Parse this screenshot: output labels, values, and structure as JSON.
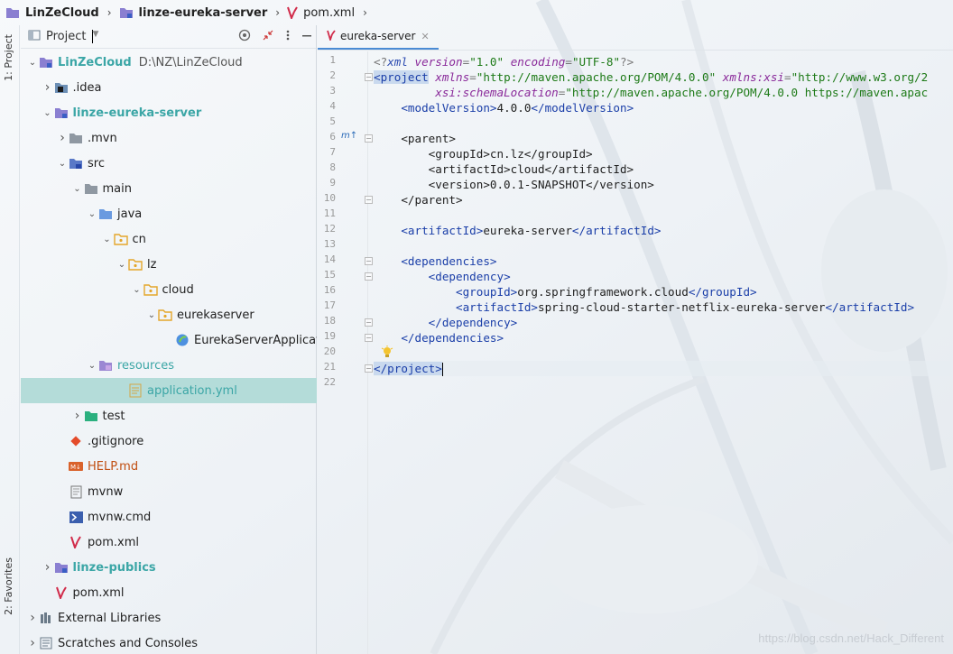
{
  "breadcrumb": {
    "items": [
      {
        "label": "LinZeCloud",
        "icon": "folder-icon"
      },
      {
        "label": "linze-eureka-server",
        "icon": "folder-icon"
      },
      {
        "label": "pom.xml",
        "icon": "maven-icon"
      }
    ]
  },
  "left_strip": {
    "project_tab": "1: Project",
    "favorites_tab": "2: Favorites"
  },
  "project_panel": {
    "title": "Project",
    "tree": [
      {
        "label": "LinZeCloud",
        "path": "D:\\NZ\\LinZeCloud",
        "depth": 0,
        "arrow": "open",
        "icon": "folder-module",
        "color": "#3ba6a6",
        "bold": true
      },
      {
        "label": ".idea",
        "depth": 1,
        "arrow": "closed",
        "icon": "folder-idea",
        "color": "#1f1f1f"
      },
      {
        "label": "linze-eureka-server",
        "depth": 1,
        "arrow": "open",
        "icon": "folder-module",
        "color": "#3ba6a6",
        "bold": true
      },
      {
        "label": ".mvn",
        "depth": 2,
        "arrow": "closed",
        "icon": "folder-gray",
        "color": "#1f1f1f"
      },
      {
        "label": "src",
        "depth": 2,
        "arrow": "open",
        "icon": "folder-src",
        "color": "#1f1f1f"
      },
      {
        "label": "main",
        "depth": 3,
        "arrow": "open",
        "icon": "folder-gray",
        "color": "#1f1f1f"
      },
      {
        "label": "java",
        "depth": 4,
        "arrow": "open",
        "icon": "folder-blue",
        "color": "#1f1f1f"
      },
      {
        "label": "cn",
        "depth": 5,
        "arrow": "open",
        "icon": "package",
        "color": "#1f1f1f"
      },
      {
        "label": "lz",
        "depth": 6,
        "arrow": "open",
        "icon": "package",
        "color": "#1f1f1f"
      },
      {
        "label": "cloud",
        "depth": 7,
        "arrow": "open",
        "icon": "package",
        "color": "#1f1f1f"
      },
      {
        "label": "eurekaserver",
        "depth": 8,
        "arrow": "open",
        "icon": "package",
        "color": "#1f1f1f"
      },
      {
        "label": "EurekaServerApplication",
        "depth": 10,
        "arrow": "none",
        "icon": "spring-class",
        "color": "#1f1f1f"
      },
      {
        "label": "resources",
        "depth": 4,
        "arrow": "open",
        "icon": "folder-resources",
        "color": "#3ba6a6"
      },
      {
        "label": "application.yml",
        "depth": 6,
        "arrow": "none",
        "icon": "yml",
        "color": "#3ba6a6",
        "selected": true
      },
      {
        "label": "test",
        "depth": 3,
        "arrow": "closed",
        "icon": "folder-test",
        "color": "#1f1f1f"
      },
      {
        "label": ".gitignore",
        "depth": 2,
        "arrow": "none",
        "icon": "git",
        "color": "#1f1f1f"
      },
      {
        "label": "HELP.md",
        "depth": 2,
        "arrow": "none",
        "icon": "markdown",
        "color": "#c14f12"
      },
      {
        "label": "mvnw",
        "depth": 2,
        "arrow": "none",
        "icon": "text-file",
        "color": "#1f1f1f"
      },
      {
        "label": "mvnw.cmd",
        "depth": 2,
        "arrow": "none",
        "icon": "cmd",
        "color": "#1f1f1f"
      },
      {
        "label": "pom.xml",
        "depth": 2,
        "arrow": "none",
        "icon": "maven",
        "color": "#1f1f1f"
      },
      {
        "label": "linze-publics",
        "depth": 1,
        "arrow": "closed",
        "icon": "folder-module",
        "color": "#3ba6a6",
        "bold": true
      },
      {
        "label": "pom.xml",
        "depth": 1,
        "arrow": "none",
        "icon": "maven",
        "color": "#1f1f1f"
      },
      {
        "label": "External Libraries",
        "depth": 0,
        "arrow": "closed",
        "icon": "libraries",
        "color": "#1f1f1f"
      },
      {
        "label": "Scratches and Consoles",
        "depth": 0,
        "arrow": "closed",
        "icon": "scratches",
        "color": "#1f1f1f"
      }
    ]
  },
  "editor": {
    "tab_label": "eureka-server",
    "code_lines": [
      [
        [
          "pi",
          "<?"
        ],
        [
          "an",
          "xml "
        ],
        [
          "ap",
          "version"
        ],
        [
          "pi",
          "="
        ],
        [
          "av",
          "\"1.0\""
        ],
        [
          "pi",
          " "
        ],
        [
          "ap",
          "encoding"
        ],
        [
          "pi",
          "="
        ],
        [
          "av",
          "\"UTF-8\""
        ],
        [
          "pi",
          "?>"
        ]
      ],
      [
        [
          "hl",
          "<project"
        ],
        [
          "pi",
          " "
        ],
        [
          "ap",
          "xmlns"
        ],
        [
          "pi",
          "="
        ],
        [
          "av",
          "\"http://maven.apache.org/POM/4.0.0\""
        ],
        [
          "pi",
          " "
        ],
        [
          "ap",
          "xmlns:"
        ],
        [
          "ap",
          "xsi"
        ],
        [
          "pi",
          "="
        ],
        [
          "av",
          "\"http://www.w3.org/2"
        ]
      ],
      [
        [
          "tx",
          "         "
        ],
        [
          "ap",
          "xsi"
        ],
        [
          "ap",
          ":schemaLocation"
        ],
        [
          "pi",
          "="
        ],
        [
          "av",
          "\"http://maven.apache.org/POM/4.0.0 https://maven.apac"
        ]
      ],
      [
        [
          "tx",
          "    "
        ],
        [
          "t",
          "<modelVersion>"
        ],
        [
          "tx",
          "4.0.0"
        ],
        [
          "t",
          "</modelVersion>"
        ]
      ],
      [],
      [
        [
          "tx",
          "    <parent>"
        ]
      ],
      [
        [
          "tx",
          "        <groupId>cn.lz</groupId>"
        ]
      ],
      [
        [
          "tx",
          "        <artifactId>cloud</artifactId>"
        ]
      ],
      [
        [
          "tx",
          "        <version>0.0.1-SNAPSHOT</version>"
        ]
      ],
      [
        [
          "tx",
          "    </parent>"
        ]
      ],
      [],
      [
        [
          "tx",
          "    "
        ],
        [
          "t",
          "<artifactId>"
        ],
        [
          "tx",
          "eureka-server"
        ],
        [
          "t",
          "</artifactId>"
        ]
      ],
      [],
      [
        [
          "tx",
          "    "
        ],
        [
          "t",
          "<dependencies>"
        ]
      ],
      [
        [
          "tx",
          "        "
        ],
        [
          "t",
          "<dependency>"
        ]
      ],
      [
        [
          "tx",
          "            "
        ],
        [
          "t",
          "<groupId>"
        ],
        [
          "tx",
          "org.springframework.cloud"
        ],
        [
          "t",
          "</groupId>"
        ]
      ],
      [
        [
          "tx",
          "            "
        ],
        [
          "t",
          "<artifactId>"
        ],
        [
          "tx",
          "spring-cloud-starter-netflix-eureka-server"
        ],
        [
          "t",
          "</artifactId>"
        ]
      ],
      [
        [
          "tx",
          "        "
        ],
        [
          "t",
          "</dependency>"
        ]
      ],
      [
        [
          "tx",
          "    "
        ],
        [
          "t",
          "</dependencies>"
        ]
      ],
      [],
      [
        [
          "hl",
          "</project>"
        ]
      ],
      []
    ],
    "gutter_marker": "m↑"
  },
  "watermark": "https://blog.csdn.net/Hack_Different"
}
